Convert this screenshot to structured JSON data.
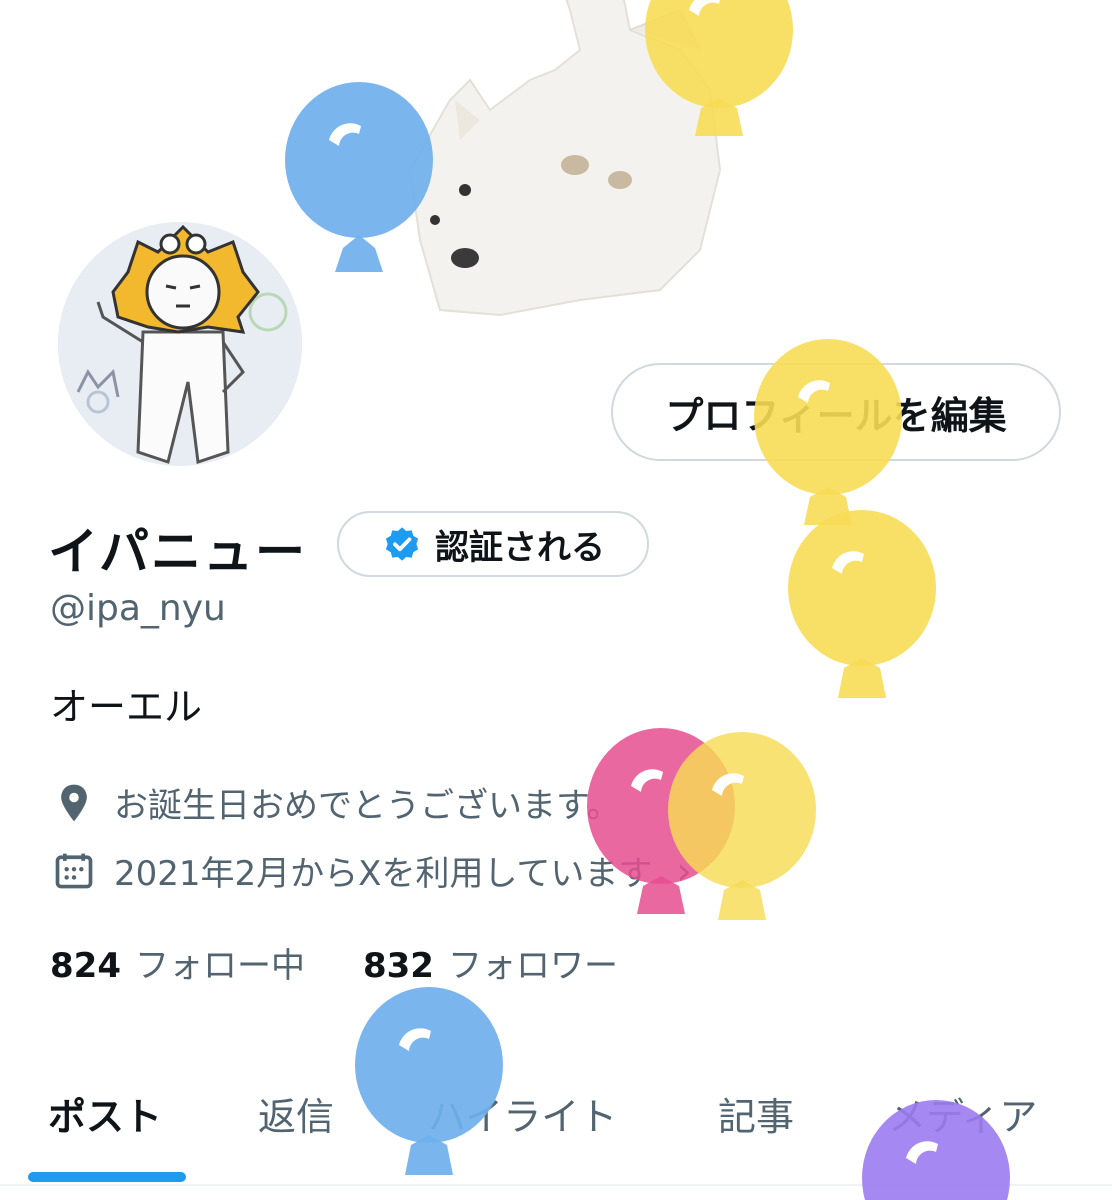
{
  "profile": {
    "edit_label": "プロフィールを編集",
    "name": "イパニュー",
    "verify_label": "認証される",
    "handle": "@ipa_nyu",
    "bio": "オーエル",
    "location": "お誕生日おめでとうございます。",
    "joined": "2021年2月からXを利用しています",
    "following_count": "824",
    "following_label": "フォロー中",
    "followers_count": "832",
    "followers_label": "フォロワー"
  },
  "tabs": [
    {
      "label": "ポスト"
    },
    {
      "label": "返信"
    },
    {
      "label": "ハイライト"
    },
    {
      "label": "記事"
    },
    {
      "label": "メディア"
    }
  ],
  "icons": {
    "location": "map-pin-icon",
    "calendar": "calendar-icon",
    "verified": "verified-badge-icon",
    "chevron": "chevron-right-icon"
  },
  "colors": {
    "accent": "#1d9bf0",
    "secondary_text": "#536471",
    "balloon_blue": "#6fb0ec",
    "balloon_yellow": "#f7dc55",
    "balloon_pink": "#e64d8f",
    "balloon_purple": "#9b7bef"
  }
}
